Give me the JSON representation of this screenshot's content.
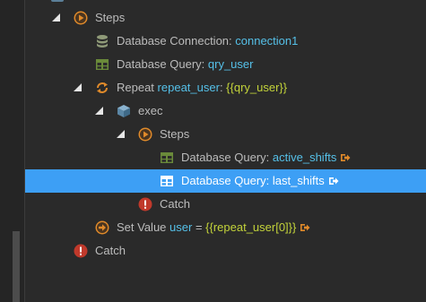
{
  "tree": {
    "rows": [
      {
        "label": "Steps"
      },
      {
        "label": "Database Connection: ",
        "value": "connection1"
      },
      {
        "label": "Database Query: ",
        "value": "qry_user"
      },
      {
        "label": "Repeat ",
        "value": "repeat_user",
        "sep": ": ",
        "expr": "{{qry_user}}"
      },
      {
        "label": "exec"
      },
      {
        "label": "Steps"
      },
      {
        "label": "Database Query: ",
        "value": "active_shifts"
      },
      {
        "label": "Database Query: ",
        "value": "last_shifts"
      },
      {
        "label": "Catch"
      },
      {
        "label": "Set Value ",
        "value": "user",
        "sep": " = ",
        "expr": "{{repeat_user[0]}}"
      },
      {
        "label": "Catch"
      }
    ]
  },
  "colors": {
    "selection": "#3d9ff5",
    "value_text": "#55c0e8",
    "expression_text": "#c3d33a",
    "steps_icon": "#e08a2a",
    "catch_icon": "#c0392b",
    "query_icon": "#6a8a3a"
  },
  "icons": {
    "steps": "play-circle-icon",
    "connection": "database-icon",
    "query": "table-icon",
    "repeat": "repeat-icon",
    "exec": "cube-icon",
    "catch": "exclamation-circle-icon",
    "set_value": "arrow-right-circle-icon",
    "link": "sign-out-icon"
  }
}
